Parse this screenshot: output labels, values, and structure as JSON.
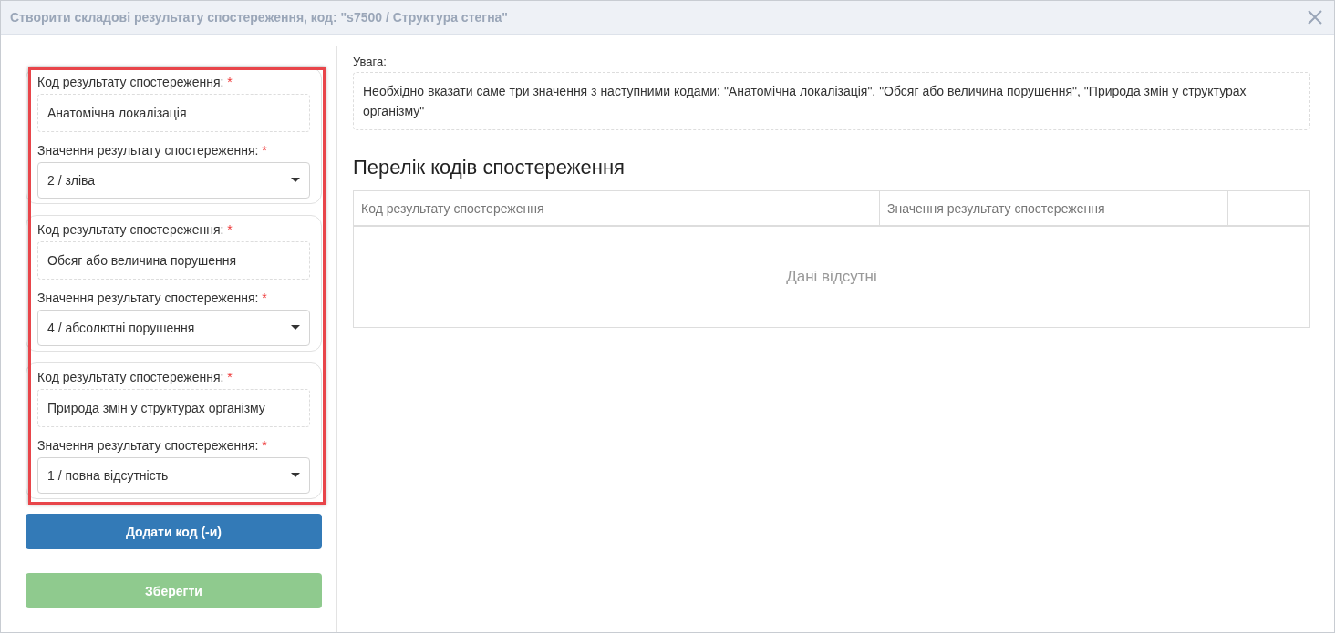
{
  "window": {
    "title": "Створити складові результату спостереження, код: \"s7500 / Структура стегна\""
  },
  "components": [
    {
      "code_label": "Код результату спостереження:",
      "code_mark": "*",
      "code_value": "Анатомічна локалізація",
      "value_label": "Значення результату спостереження:",
      "value_mark": "*",
      "value": "2 / зліва"
    },
    {
      "code_label": "Код результату спостереження:",
      "code_mark": "*",
      "code_value": "Обсяг або величина порушення",
      "value_label": "Значення результату спостереження:",
      "value_mark": "*",
      "value": "4 / абсолютні порушення"
    },
    {
      "code_label": "Код результату спостереження:",
      "code_mark": "*",
      "code_value": "Природа змін у структурах організму",
      "value_label": "Значення результату спостереження:",
      "value_mark": "*",
      "value": "1 / повна відсутність"
    }
  ],
  "add_button": {
    "label": "Додати код (-и)"
  },
  "save_button": {
    "label": "Зберегти",
    "disabled": true
  },
  "notice": {
    "label": "Увага:",
    "text": "Необхідно вказати саме три значення з наступними кодами:  \"Анатомічна локалізація\", \"Обсяг або величина порушення\", \"Природа змін у структурах організму\""
  },
  "codes_table": {
    "title": "Перелік кодів спостереження",
    "columns": [
      "Код результату спостереження",
      "Значення результату спостереження"
    ],
    "empty_text": "Дані відсутні"
  }
}
